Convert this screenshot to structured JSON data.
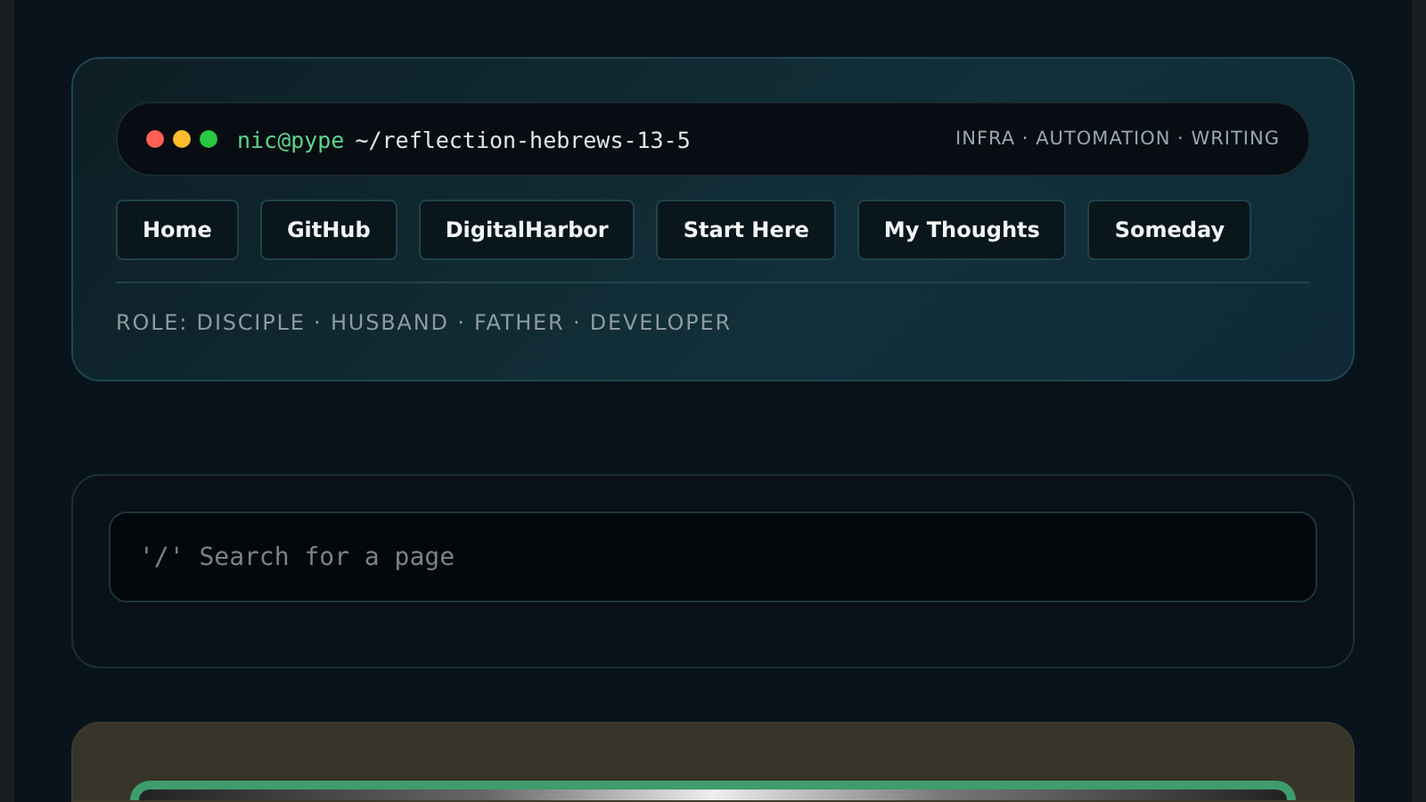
{
  "terminal": {
    "user": "nic@pype",
    "path": "~/reflection-hebrews-13-5",
    "tagline": "INFRA · AUTOMATION · WRITING"
  },
  "nav": [
    "Home",
    "GitHub",
    "DigitalHarbor",
    "Start Here",
    "My Thoughts",
    "Someday"
  ],
  "role": "ROLE: DISCIPLE · HUSBAND · FATHER · DEVELOPER",
  "search": {
    "placeholder": "'/' Search for a page"
  }
}
